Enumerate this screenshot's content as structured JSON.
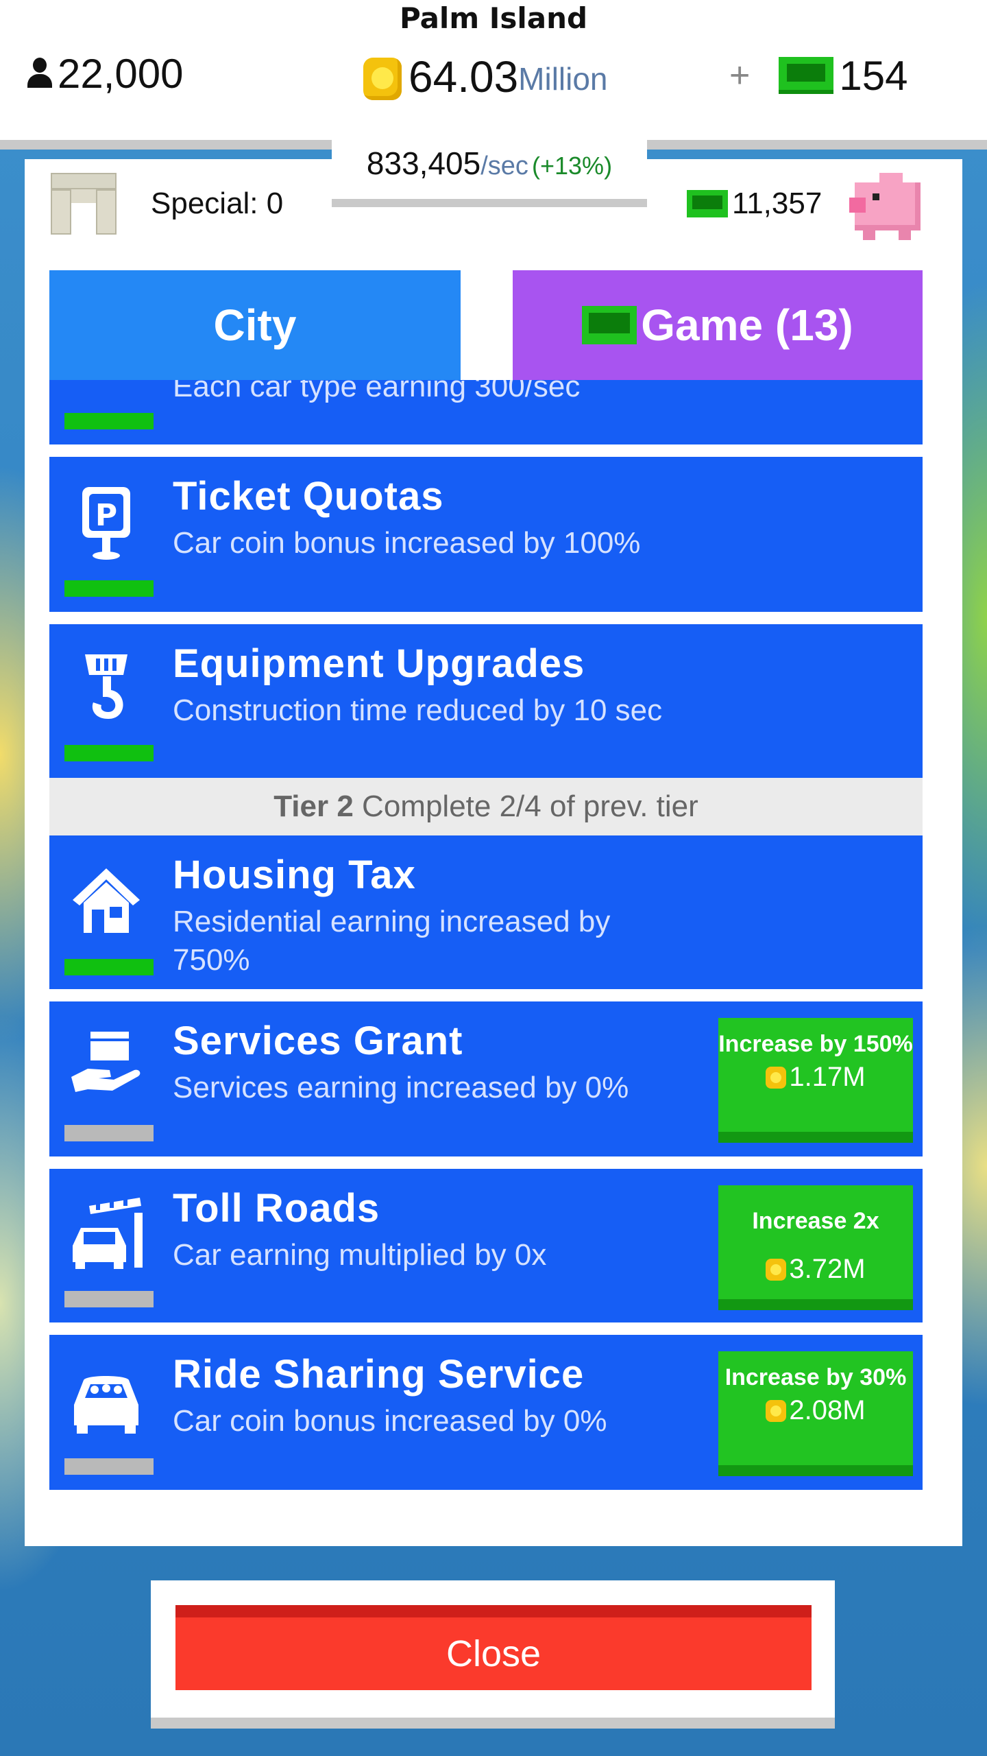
{
  "header": {
    "island_name": "Palm Island",
    "population": "22,000",
    "coins": "64.03",
    "coins_unit": "Million",
    "add_symbol": "+",
    "cash": "154",
    "income_rate": "833,405",
    "income_unit": "/sec",
    "income_bonus": "(+13%)"
  },
  "panel": {
    "special_label": "Special: 0",
    "bank_cash": "11,357",
    "tabs": [
      {
        "label": "City"
      },
      {
        "label": "Game (13)"
      }
    ],
    "upgrades": [
      {
        "title": "",
        "desc": "Each car type earning  300/sec",
        "icon": "car-icon",
        "purchased": true
      },
      {
        "title": "Ticket Quotas",
        "desc": "Car coin bonus increased by 100%",
        "icon": "parking-sign-icon",
        "purchased": true
      },
      {
        "title": "Equipment Upgrades",
        "desc": "Construction time reduced by 10 sec",
        "icon": "crane-hook-icon",
        "purchased": true
      },
      {
        "title": "Housing Tax",
        "desc": "Residential earning increased by 750%",
        "icon": "house-icon",
        "purchased": true
      },
      {
        "title": "Services Grant",
        "desc": "Services earning increased by 0%",
        "icon": "hand-box-icon",
        "purchased": false,
        "buy_text": "Increase by 150%",
        "price": "1.17M"
      },
      {
        "title": "Toll Roads",
        "desc": "Car earning multiplied by 0x",
        "icon": "toll-gate-icon",
        "purchased": false,
        "buy_text": "Increase 2x",
        "price": "3.72M"
      },
      {
        "title": "Ride Sharing Service",
        "desc": "Car coin bonus increased by 0%",
        "icon": "rideshare-car-icon",
        "purchased": false,
        "buy_text": "Increase by 30%",
        "price": "2.08M"
      }
    ],
    "tier": {
      "label": "Tier 2",
      "text": "Complete 2/4 of prev. tier"
    }
  },
  "footer": {
    "close_label": "Close"
  },
  "colors": {
    "row_blue": "#165ef5",
    "city_tab": "#2488f5",
    "game_tab": "#a854f0",
    "buy_green": "#22c422",
    "close_red": "#fb3a2c"
  }
}
